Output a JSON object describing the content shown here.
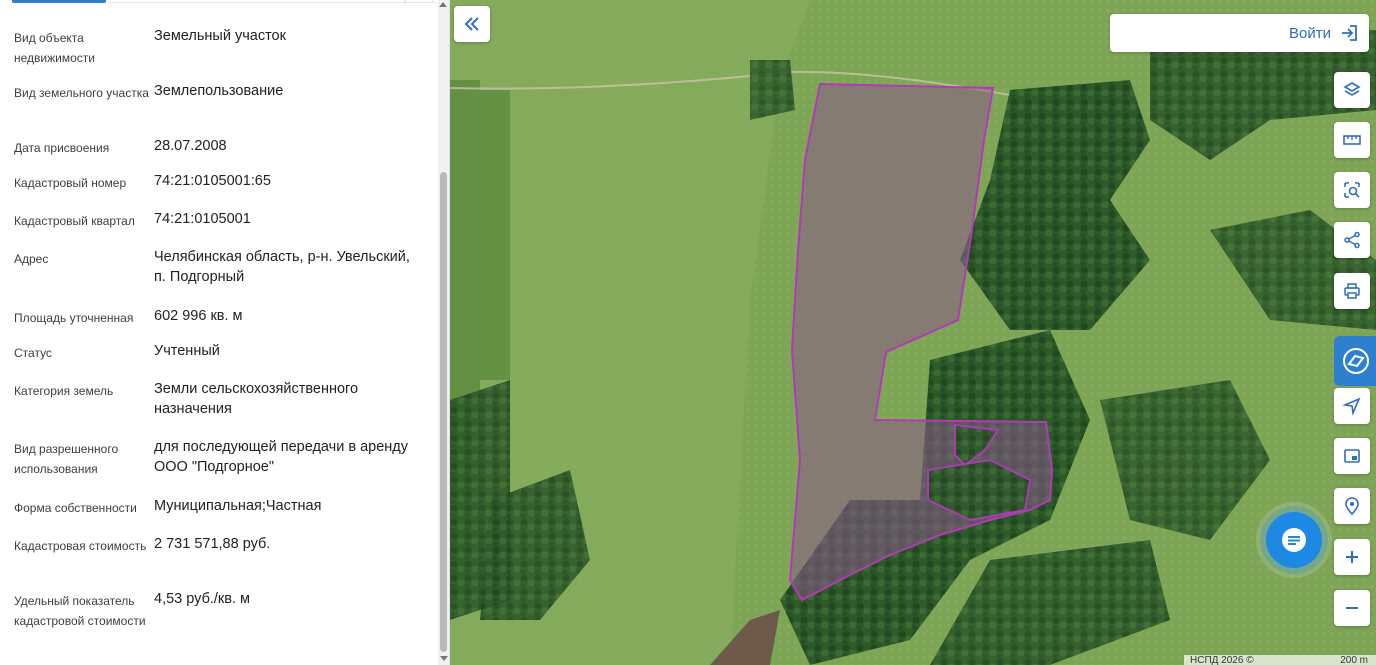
{
  "panel": {
    "properties": [
      {
        "label": "Вид объекта недвижимости",
        "value": "Земельный участок"
      },
      {
        "label": "Вид земельного участка",
        "value": "Землепользование"
      },
      {
        "label": "Дата присвоения",
        "value": "28.07.2008"
      },
      {
        "label": "Кадастровый номер",
        "value": "74:21:0105001:65"
      },
      {
        "label": "Кадастровый квартал",
        "value": "74:21:0105001"
      },
      {
        "label": "Адрес",
        "value": "Челябинская область, р-н. Увельский, п. Подгорный"
      },
      {
        "label": "Площадь уточненная",
        "value": "602 996 кв. м"
      },
      {
        "label": "Статус",
        "value": "Учтенный"
      },
      {
        "label": "Категория земель",
        "value": "Земли сельскохозяйственного назначения"
      },
      {
        "label": "Вид разрешенного использования",
        "value": "для последующей передачи в аренду ООО \"Подгорное\""
      },
      {
        "label": "Форма собственности",
        "value": "Муниципальная;Частная"
      },
      {
        "label": "Кадастровая стоимость",
        "value": "2 731 571,88 руб."
      },
      {
        "label": "Удельный показатель кадастровой стоимости",
        "value": "4,53 руб./кв. м"
      }
    ]
  },
  "map": {
    "login_label": "Войти",
    "attribution": "НСПД 2026 ©",
    "scale_label": "200 m",
    "controls": [
      "layers-icon",
      "ruler-icon",
      "area-select-icon",
      "share-icon",
      "print-icon",
      "navigate-icon",
      "minimap-icon",
      "locate-icon",
      "zoom-in-icon",
      "zoom-out-icon"
    ],
    "accent_color": "#2e6fb7",
    "parcel_color": "#9b2fae"
  }
}
